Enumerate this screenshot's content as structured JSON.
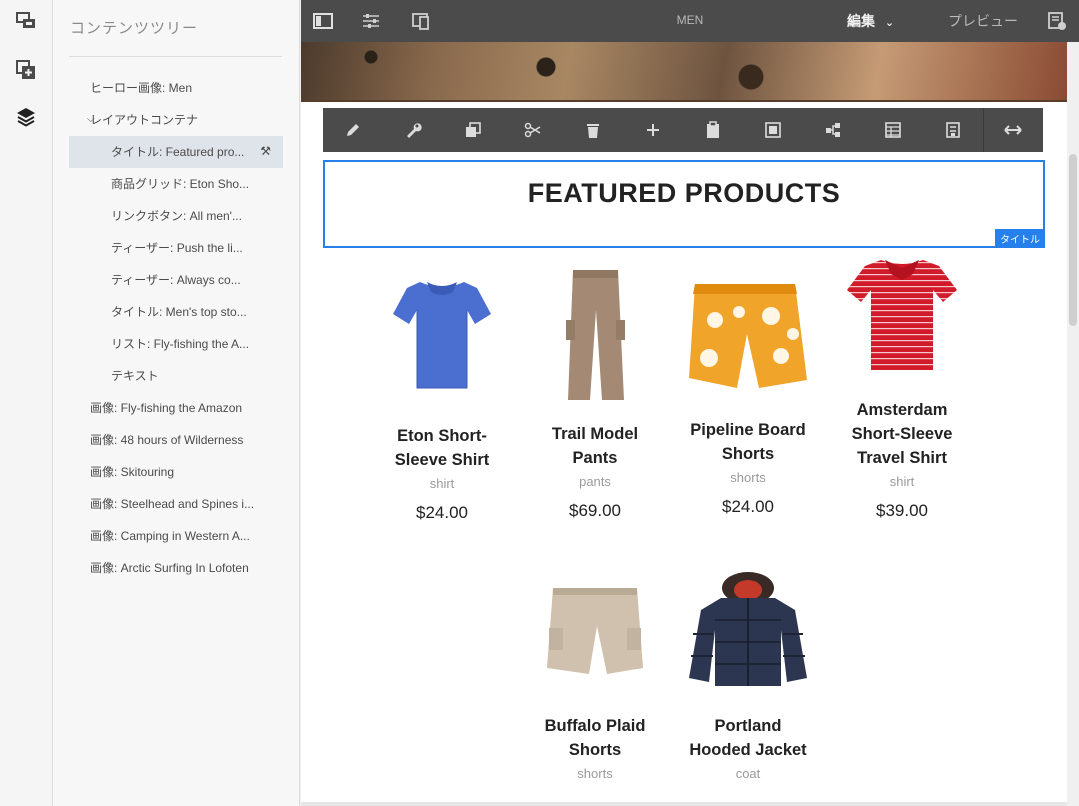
{
  "rail": {
    "icons": [
      "site-structure-icon",
      "add-component-icon",
      "layers-icon"
    ]
  },
  "panel": {
    "title": "コンテンツツリー",
    "tree": [
      {
        "label": "ヒーロー画像: Men",
        "level": 1
      },
      {
        "label": "レイアウトコンテナ",
        "level": 1,
        "expanded": true
      },
      {
        "label": "タイトル: Featured pro...",
        "level": 2,
        "selected": true
      },
      {
        "label": "商品グリッド: Eton Sho...",
        "level": 2
      },
      {
        "label": "リンクボタン: All men'...",
        "level": 2
      },
      {
        "label": "ティーザー: Push the li...",
        "level": 2
      },
      {
        "label": "ティーザー: Always co...",
        "level": 2
      },
      {
        "label": "タイトル: Men's top sto...",
        "level": 2
      },
      {
        "label": "リスト: Fly-fishing the A...",
        "level": 2
      },
      {
        "label": "テキスト",
        "level": 2
      },
      {
        "label": "画像: Fly-fishing the Amazon",
        "level": 1
      },
      {
        "label": "画像: 48 hours of Wilderness",
        "level": 1
      },
      {
        "label": "画像: Skitouring",
        "level": 1
      },
      {
        "label": "画像: Steelhead and Spines i...",
        "level": 1
      },
      {
        "label": "画像: Camping in Western A...",
        "level": 1
      },
      {
        "label": "画像: Arctic Surfing In Lofoten",
        "level": 1
      }
    ]
  },
  "topbar": {
    "page_title": "MEN",
    "mode_label": "編集",
    "preview_label": "プレビュー",
    "icons": [
      "side-panel-icon",
      "page-properties-icon",
      "emulator-icon",
      "page-info-icon"
    ]
  },
  "edit_toolbar": {
    "icons": [
      "pencil-icon",
      "wrench-icon",
      "copy-icon",
      "cut-icon",
      "delete-icon",
      "insert-icon",
      "paste-icon",
      "group-icon",
      "parent-icon",
      "layout-icon",
      "template-icon",
      "resize-icon"
    ]
  },
  "title_component": {
    "heading": "FEATURED PRODUCTS",
    "tag": "タイトル"
  },
  "colors": {
    "accent": "#2680eb",
    "toolbar": "#4b4b4b"
  },
  "products": [
    {
      "name": "Eton Short-Sleeve Shirt",
      "name_lines": [
        "Eton Short-",
        "Sleeve Shirt"
      ],
      "category": "shirt",
      "price": "$24.00",
      "image": "blue-polo-shirt"
    },
    {
      "name": "Trail Model Pants",
      "name_lines": [
        "Trail Model",
        "Pants"
      ],
      "category": "pants",
      "price": "$69.00",
      "image": "khaki-cargo-pants"
    },
    {
      "name": "Pipeline Board Shorts",
      "name_lines": [
        "Pipeline Board",
        "Shorts"
      ],
      "category": "shorts",
      "price": "$24.00",
      "image": "orange-floral-board-shorts"
    },
    {
      "name": "Amsterdam Short-Sleeve Travel Shirt",
      "name_lines": [
        "Amsterdam",
        "Short-Sleeve",
        "Travel Shirt"
      ],
      "category": "shirt",
      "price": "$39.00",
      "image": "red-striped-polo"
    },
    {
      "name": "Buffalo Plaid Shorts",
      "name_lines": [
        "Buffalo Plaid",
        "Shorts"
      ],
      "category": "shorts",
      "price": "",
      "image": "beige-cargo-shorts"
    },
    {
      "name": "Portland Hooded Jacket",
      "name_lines": [
        "Portland",
        "Hooded Jacket"
      ],
      "category": "coat",
      "price": "",
      "image": "navy-puffer-jacket"
    }
  ]
}
